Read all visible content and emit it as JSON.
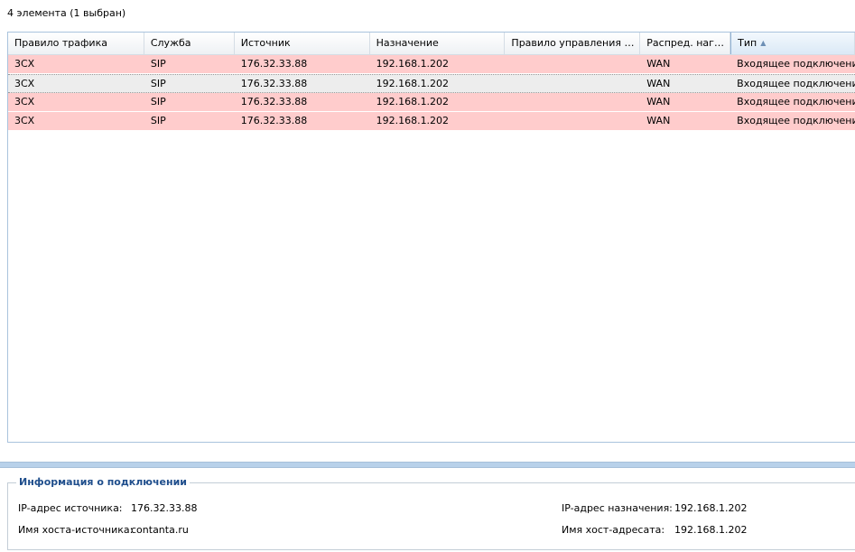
{
  "list": {
    "count_label": "4 элемента (1 выбран)",
    "columns": [
      "Правило трафика",
      "Служба",
      "Источник",
      "Назначение",
      "Правило управления пол...",
      "Распред. нагруз...",
      "Тип"
    ],
    "sorted_column": "Тип",
    "sort_direction": "ascending",
    "rows": [
      {
        "rule": "3CX",
        "service": "SIP",
        "source": "176.32.33.88",
        "destination": "192.168.1.202",
        "policy": "",
        "lb": "WAN",
        "type": "Входящее подключение",
        "state": "alert"
      },
      {
        "rule": "3CX",
        "service": "SIP",
        "source": "176.32.33.88",
        "destination": "192.168.1.202",
        "policy": "",
        "lb": "WAN",
        "type": "Входящее подключение",
        "state": "selected"
      },
      {
        "rule": "3CX",
        "service": "SIP",
        "source": "176.32.33.88",
        "destination": "192.168.1.202",
        "policy": "",
        "lb": "WAN",
        "type": "Входящее подключение",
        "state": "alert"
      },
      {
        "rule": "3CX",
        "service": "SIP",
        "source": "176.32.33.88",
        "destination": "192.168.1.202",
        "policy": "",
        "lb": "WAN",
        "type": "Входящее подключение",
        "state": "alert"
      }
    ],
    "colors": {
      "alert_row": "#ffcccc",
      "selected_row": "#ededed",
      "splitter": "#b8d1ea"
    }
  },
  "info": {
    "title": "Информация о подключении",
    "src_ip_label": "IP-адрес источника:",
    "src_ip_value": "176.32.33.88",
    "src_host_label": "Имя хоста-источника:",
    "src_host_value": "contanta.ru",
    "dst_ip_label": "IP-адрес назначения:",
    "dst_ip_value": "192.168.1.202",
    "dst_host_label": "Имя хост-адресата:",
    "dst_host_value": "192.168.1.202"
  }
}
